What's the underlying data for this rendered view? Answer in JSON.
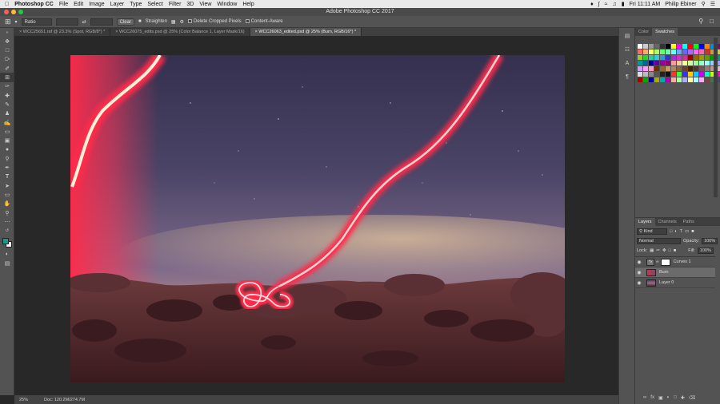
{
  "menubar": {
    "app_name": "Photoshop CC",
    "items": [
      "File",
      "Edit",
      "Image",
      "Layer",
      "Type",
      "Select",
      "Filter",
      "3D",
      "View",
      "Window",
      "Help"
    ],
    "clock": "Fri 11:11 AM",
    "user": "Philip Ebiner"
  },
  "window": {
    "title": "Adobe Photoshop CC 2017"
  },
  "options": {
    "ratio_label": "Ratio",
    "clear_label": "Clear",
    "straighten_label": "Straighten",
    "delete_cropped_label": "Delete Cropped Pixels",
    "content_aware_label": "Content-Aware"
  },
  "tabs": [
    {
      "label": "WCC25651.raf @ 23.3% (Spot, RGB/8*) *",
      "active": false
    },
    {
      "label": "WCC26075_edits.psd @ 25% (Color Balance 1, Layer Mask/16)",
      "active": false
    },
    {
      "label": "WCC26063_edited.psd @ 25% (Burn, RGB/16*) *",
      "active": true
    }
  ],
  "status": {
    "zoom": "25%",
    "doc": "Doc: 120.2M/274.7M"
  },
  "color_panel": {
    "tabs": [
      "Color",
      "Swatches"
    ],
    "active": "Swatches"
  },
  "layers_panel": {
    "tabs": [
      "Layers",
      "Channels",
      "Paths"
    ],
    "active": "Layers",
    "kind_label": "Kind",
    "blend_mode": "Normal",
    "opacity_label": "Opacity:",
    "opacity_value": "100%",
    "lock_label": "Lock:",
    "fill_label": "Fill:",
    "fill_value": "100%",
    "layers": [
      {
        "name": "Curves 1",
        "active": false
      },
      {
        "name": "Burn",
        "active": true
      },
      {
        "name": "Layer 0",
        "active": false
      }
    ]
  },
  "colors": {
    "ui_dark": "#282828",
    "panel": "#535353",
    "foreground": "#1a9a8c",
    "background": "#ffffff"
  }
}
